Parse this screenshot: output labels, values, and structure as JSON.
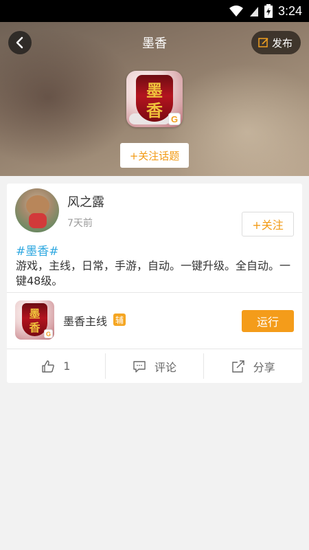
{
  "status_bar": {
    "time": "3:24"
  },
  "header": {
    "title": "墨香",
    "publish_label": "发布",
    "follow_topic_label": "+关注话题",
    "topic_icon_text": [
      "墨",
      "香"
    ],
    "icon_badge": "G"
  },
  "post": {
    "username": "风之露",
    "time": "7天前",
    "follow_label": "+关注",
    "hashtag": "#墨香#",
    "text": "游戏，主线，日常，手游，自动。一键升级。全自动。一键48级。"
  },
  "app": {
    "name": "墨香主线",
    "badge": "辅",
    "run_label": "运行"
  },
  "actions": {
    "like_count": "1",
    "comment_label": "评论",
    "share_label": "分享"
  },
  "colors": {
    "accent": "#f49c1a",
    "hashtag": "#2fa8e0"
  }
}
